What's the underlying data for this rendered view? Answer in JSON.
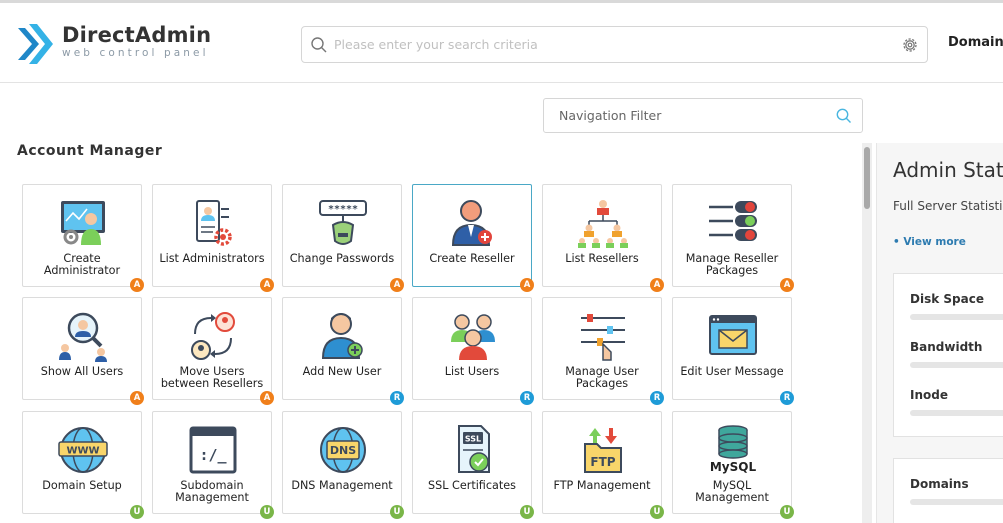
{
  "header": {
    "logo": {
      "title": "DirectAdmin",
      "subtitle": "web control panel"
    },
    "search_placeholder": "Please enter your search criteria",
    "domain_link": "Domain"
  },
  "nav_filter": {
    "placeholder": "Navigation Filter"
  },
  "section": {
    "title": "Account Manager"
  },
  "tiles": [
    {
      "label": "Create Administrator",
      "badge": "A",
      "icon": "create-administrator-icon"
    },
    {
      "label": "List Administrators",
      "badge": "A",
      "icon": "list-administrators-icon"
    },
    {
      "label": "Change Passwords",
      "badge": "A",
      "icon": "change-passwords-icon"
    },
    {
      "label": "Create Reseller",
      "badge": "A",
      "icon": "create-reseller-icon"
    },
    {
      "label": "List Resellers",
      "badge": "A",
      "icon": "list-resellers-icon"
    },
    {
      "label": "Manage Reseller Packages",
      "badge": "A",
      "icon": "manage-reseller-packages-icon"
    },
    {
      "label": "Show All Users",
      "badge": "A",
      "icon": "show-all-users-icon"
    },
    {
      "label": "Move Users between Resellers",
      "badge": "A",
      "icon": "move-users-icon"
    },
    {
      "label": "Add New User",
      "badge": "R",
      "icon": "add-new-user-icon"
    },
    {
      "label": "List Users",
      "badge": "R",
      "icon": "list-users-icon"
    },
    {
      "label": "Manage User Packages",
      "badge": "R",
      "icon": "manage-user-packages-icon"
    },
    {
      "label": "Edit User Message",
      "badge": "R",
      "icon": "edit-user-message-icon"
    },
    {
      "label": "Domain Setup",
      "badge": "U",
      "icon": "domain-setup-icon"
    },
    {
      "label": "Subdomain Management",
      "badge": "U",
      "icon": "subdomain-management-icon"
    },
    {
      "label": "DNS Management",
      "badge": "U",
      "icon": "dns-management-icon"
    },
    {
      "label": "SSL Certificates",
      "badge": "U",
      "icon": "ssl-certificates-icon"
    },
    {
      "label": "FTP Management",
      "badge": "U",
      "icon": "ftp-management-icon"
    },
    {
      "label": "MySQL Management",
      "badge": "U",
      "icon": "mysql-management-icon"
    }
  ],
  "icon_text": {
    "www": "WWW",
    "dns": "DNS",
    "ssl": "SSL",
    "ftp": "FTP",
    "mysql": "MySQL",
    "cmd": ":/_",
    "password": "*****"
  },
  "stats": {
    "title": "Admin Stats",
    "subtitle": "Full Server Statistics",
    "view_more": "• View more",
    "items": [
      "Disk Space",
      "Bandwidth",
      "Inode"
    ],
    "domains_label": "Domains"
  },
  "colors": {
    "accent": "#1e9bd7",
    "badge_admin": "#f07f1a",
    "badge_reseller": "#1e9bd7",
    "badge_user": "#7ab648",
    "active_border": "#4aa8c6"
  }
}
